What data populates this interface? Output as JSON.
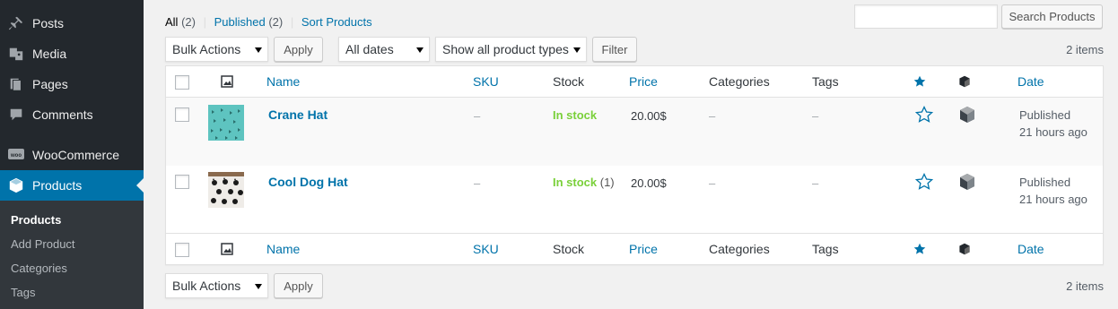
{
  "sidebar": {
    "items": [
      {
        "label": "Posts",
        "icon": "pin-icon"
      },
      {
        "label": "Media",
        "icon": "media-icon"
      },
      {
        "label": "Pages",
        "icon": "pages-icon"
      },
      {
        "label": "Comments",
        "icon": "comment-icon"
      },
      {
        "label": "WooCommerce",
        "icon": "woocommerce-icon"
      },
      {
        "label": "Products",
        "icon": "product-box-icon",
        "active": true
      }
    ],
    "submenu": [
      {
        "label": "Products",
        "current": true
      },
      {
        "label": "Add Product"
      },
      {
        "label": "Categories"
      },
      {
        "label": "Tags"
      }
    ]
  },
  "views": {
    "all_label": "All",
    "all_count": "(2)",
    "published_label": "Published",
    "published_count": "(2)",
    "sort_label": "Sort Products",
    "separator": "|"
  },
  "search": {
    "value": "",
    "button_label": "Search Products"
  },
  "top_actions": {
    "bulk_actions": "Bulk Actions",
    "apply_label": "Apply",
    "dates": "All dates",
    "product_types": "Show all product types",
    "filter_label": "Filter",
    "items_count": "2 items"
  },
  "bottom_actions": {
    "bulk_actions": "Bulk Actions",
    "apply_label": "Apply",
    "items_count": "2 items"
  },
  "columns": {
    "name": "Name",
    "sku": "SKU",
    "stock": "Stock",
    "price": "Price",
    "categories": "Categories",
    "tags": "Tags",
    "date": "Date"
  },
  "products": [
    {
      "name": "Crane Hat",
      "sku": "–",
      "stock": "In stock",
      "stock_qty": "",
      "price": "20.00$",
      "categories": "–",
      "tags": "–",
      "status": "Published",
      "date": "21 hours ago",
      "thumb": "teal-crane-pattern"
    },
    {
      "name": "Cool Dog Hat",
      "sku": "–",
      "stock": "In stock",
      "stock_qty": "(1)",
      "price": "20.00$",
      "categories": "–",
      "tags": "–",
      "status": "Published",
      "date": "21 hours ago",
      "thumb": "black-dog-pattern"
    }
  ],
  "colors": {
    "link": "#0073aa",
    "in_stock": "#7ad03a",
    "sidebar_bg": "#23282d",
    "active_bg": "#0073aa"
  }
}
